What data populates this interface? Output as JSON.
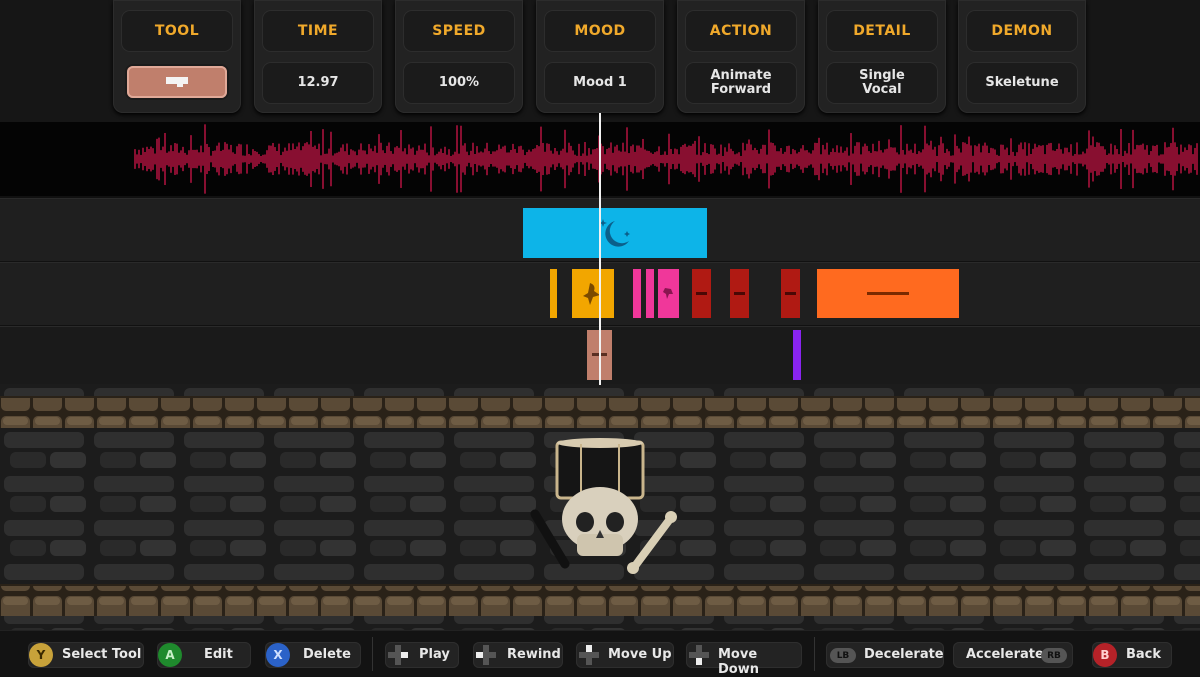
{
  "header": {
    "cards": [
      {
        "label": "TOOL",
        "value": ""
      },
      {
        "label": "TIME",
        "value": "12.97"
      },
      {
        "label": "SPEED",
        "value": "100%"
      },
      {
        "label": "MOOD",
        "value": "Mood 1"
      },
      {
        "label": "ACTION",
        "value": "Animate\nForward"
      },
      {
        "label": "DETAIL",
        "value": "Single\nVocal"
      },
      {
        "label": "DEMON",
        "value": "Skeletune"
      }
    ]
  },
  "colors": {
    "accent": "#f0a92b",
    "waveform": "#e0174f",
    "mood_clip": "#0db4e8",
    "track_yellow": "#f2a600",
    "track_pink": "#f0379a",
    "track_red": "#b01a13",
    "track_orange": "#ff6a1f",
    "track_salmon": "#c07f6c",
    "track_purple": "#8a24f0"
  },
  "icons": {
    "tool": "speech-bubble-icon",
    "mood": "moon-stars-icon",
    "demon": "skull-drum-icon"
  },
  "footer": {
    "select_tool": {
      "button": "Y",
      "label": "Select Tool",
      "color": "#c8a23a"
    },
    "edit": {
      "button": "A",
      "label": "Edit",
      "color": "#1f8a2d"
    },
    "delete": {
      "button": "X",
      "label": "Delete",
      "color": "#2b62c8"
    },
    "play": {
      "label": "Play"
    },
    "rewind": {
      "label": "Rewind"
    },
    "move_up": {
      "label": "Move Up"
    },
    "move_down": {
      "label": "Move Down"
    },
    "decelerate": {
      "button": "LB",
      "label": "Decelerate"
    },
    "accelerate": {
      "button": "RB",
      "label": "Accelerate"
    },
    "back": {
      "button": "B",
      "label": "Back",
      "color": "#b52228"
    }
  }
}
